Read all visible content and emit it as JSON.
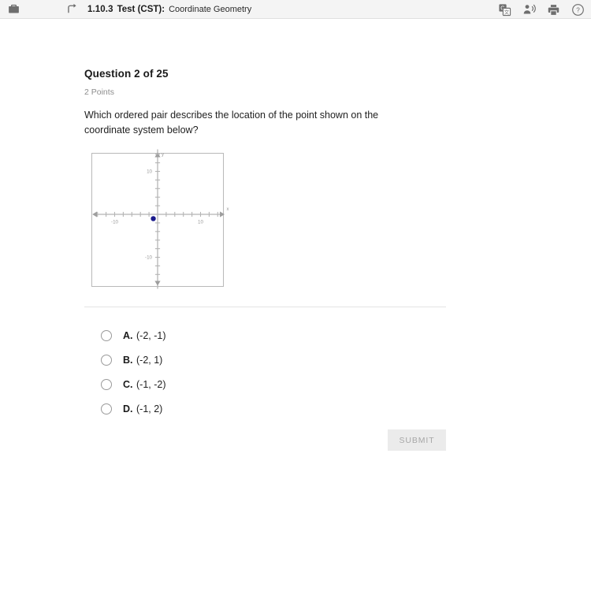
{
  "topbar": {
    "briefcase_icon": "briefcase-icon",
    "back_icon": "back-arrow-icon",
    "lesson_number": "1.10.3",
    "test_label": "Test (CST):",
    "subject": "Coordinate Geometry",
    "icons": [
      {
        "name": "translate-icon",
        "label": "Translate"
      },
      {
        "name": "read-aloud-icon",
        "label": "Read aloud"
      },
      {
        "name": "print-icon",
        "label": "Print"
      },
      {
        "name": "help-icon",
        "label": "Help"
      }
    ]
  },
  "question": {
    "title": "Question 2 of 25",
    "points": "2 Points",
    "prompt": "Which ordered pair describes the location of the point shown on the coordinate system below?"
  },
  "chart_data": {
    "type": "scatter",
    "title": "",
    "xlabel": "x",
    "ylabel": "y",
    "xlim": [
      -14,
      14
    ],
    "ylim": [
      -14,
      14
    ],
    "tick_step": 2,
    "labeled_ticks_x": [
      "-10",
      "10"
    ],
    "labeled_ticks_y": [
      "10",
      "-10"
    ],
    "grid": false,
    "points": [
      {
        "x": -1,
        "y": -1,
        "color": "#1a1a8c",
        "radius": 3.2
      }
    ],
    "axis_color": "#b5b5b5",
    "tick_label_color": "#9a9a9a"
  },
  "choices": [
    {
      "letter": "A.",
      "text": "(-2, -1)",
      "selected": false
    },
    {
      "letter": "B.",
      "text": "(-2, 1)",
      "selected": false
    },
    {
      "letter": "C.",
      "text": "(-1, -2)",
      "selected": false
    },
    {
      "letter": "D.",
      "text": "(-1, 2)",
      "selected": false
    }
  ],
  "submit": {
    "label": "SUBMIT",
    "enabled": false
  }
}
